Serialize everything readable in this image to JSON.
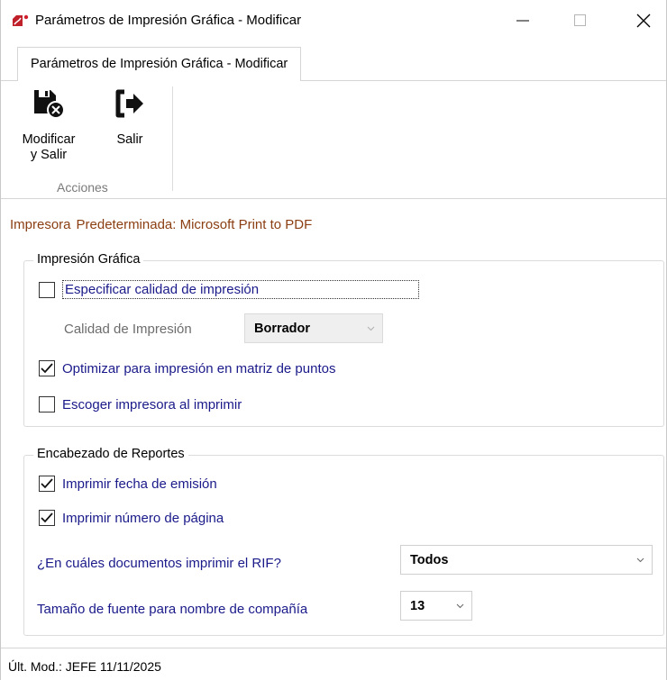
{
  "window": {
    "title": "Parámetros de Impresión Gráfica - Modificar",
    "app_icon": "pdf-app-icon",
    "controls": {
      "minimize": "minimize-icon",
      "maximize": "maximize-icon",
      "close": "close-icon"
    }
  },
  "ribbon": {
    "tab_label": "Parámetros de Impresión Gráfica - Modificar",
    "buttons": [
      {
        "label_line1": "Modificar",
        "label_line2": "y Salir",
        "icon": "save-cancel-icon"
      },
      {
        "label_line1": "Salir",
        "icon": "exit-icon"
      }
    ],
    "group_label": "Acciones"
  },
  "printer": {
    "label": "Impresora",
    "value": "Predeterminada: Microsoft Print to PDF",
    "color": "#8b3e12"
  },
  "impresion_grafica": {
    "legend": "Impresión Gráfica",
    "especificar_calidad": {
      "label": "Especificar calidad de impresión",
      "checked": false
    },
    "calidad": {
      "label": "Calidad de Impresión",
      "value": "Borrador",
      "enabled": false
    },
    "optimizar_matriz": {
      "label": "Optimizar para impresión en matriz de puntos",
      "checked": true
    },
    "escoger_impresora": {
      "label": "Escoger impresora al imprimir",
      "checked": false
    }
  },
  "encabezado": {
    "legend": "Encabezado de Reportes",
    "fecha_emision": {
      "label": "Imprimir fecha de emisión",
      "checked": true
    },
    "numero_pagina": {
      "label": "Imprimir número de página",
      "checked": true
    },
    "rif": {
      "label": "¿En cuáles documentos imprimir el RIF?",
      "value": "Todos"
    },
    "fuente": {
      "label": "Tamaño de fuente para nombre de compañía",
      "value": "13"
    }
  },
  "status": {
    "text": "Últ. Mod.:  JEFE  11/11/2025"
  },
  "colors": {
    "label_blue": "#1a1a8a",
    "label_gray": "#6d6d6d"
  }
}
